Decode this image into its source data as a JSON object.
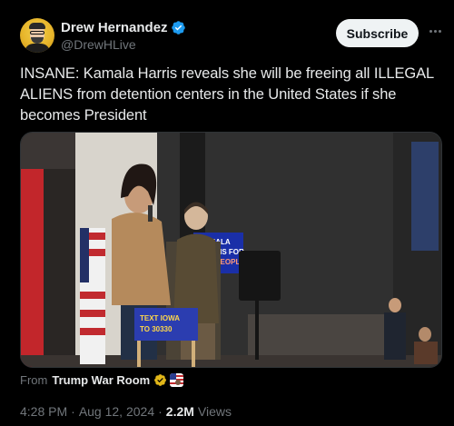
{
  "author": {
    "display_name": "Drew Hernandez",
    "handle": "@DrewHLive",
    "verified": true
  },
  "actions": {
    "subscribe_label": "Subscribe"
  },
  "tweet": {
    "text": "INSANE: Kamala Harris reveals she will be freeing all ILLEGAL ALIENS from detention centers in the United States if she becomes President"
  },
  "media": {
    "signs": {
      "blue_sign": [
        "KAMALA",
        "HARRIS FOR",
        "THE PEOPLE"
      ],
      "podium_sign": [
        "TEXT IOWA",
        "TO 30330"
      ]
    }
  },
  "source": {
    "from_label": "From",
    "from_name": "Trump War Room"
  },
  "meta": {
    "time": "4:28 PM",
    "separator": "·",
    "date": "Aug 12, 2024",
    "views_count": "2.2M",
    "views_label": "Views"
  },
  "colors": {
    "background": "#000000",
    "text": "#e7e9ea",
    "muted": "#71767b",
    "verified_blue": "#1d9bf0",
    "gold_badge": "#e2b719",
    "subscribe_bg": "#eff3f4"
  }
}
